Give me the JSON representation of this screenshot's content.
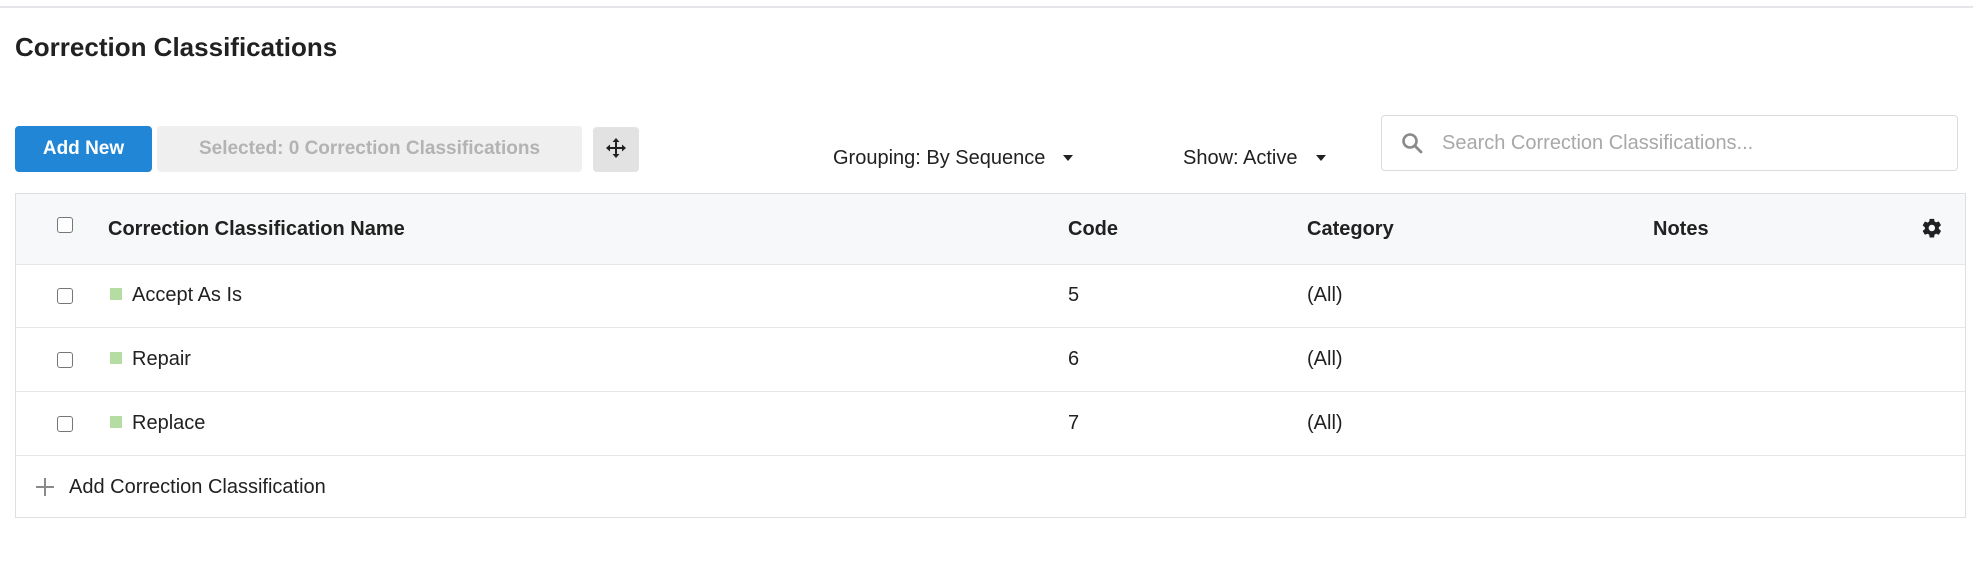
{
  "page": {
    "title": "Correction Classifications"
  },
  "toolbar": {
    "add_new_label": "Add New",
    "selected_label": "Selected: 0 Correction Classifications",
    "move_icon": "move-arrows-icon",
    "grouping_label": "Grouping: By Sequence",
    "show_label": "Show: Active"
  },
  "search": {
    "placeholder": "Search Correction Classifications...",
    "value": ""
  },
  "table": {
    "columns": {
      "name": "Correction Classification Name",
      "code": "Code",
      "category": "Category",
      "notes": "Notes"
    },
    "rows": [
      {
        "name": "Accept As Is",
        "code": "5",
        "category": "(All)",
        "notes": "",
        "color": "#b5dda1"
      },
      {
        "name": "Repair",
        "code": "6",
        "category": "(All)",
        "notes": "",
        "color": "#b5dda1"
      },
      {
        "name": "Replace",
        "code": "7",
        "category": "(All)",
        "notes": "",
        "color": "#b5dda1"
      }
    ],
    "add_row_label": "Add Correction Classification"
  },
  "colors": {
    "primary": "#2186d6",
    "swatch": "#b5dda1"
  }
}
